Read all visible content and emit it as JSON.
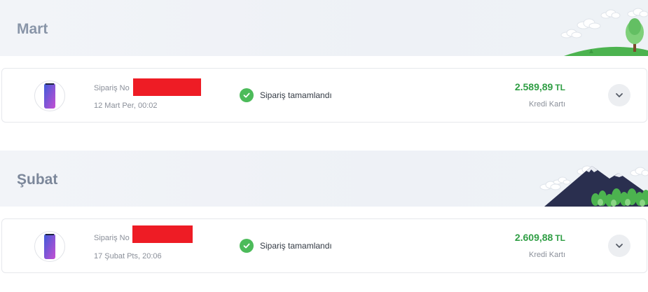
{
  "groups": [
    {
      "month": "Mart",
      "order": {
        "order_no_label": "Sipariş No",
        "date": "12 Mart Per, 00:02",
        "status": "Sipariş tamamlandı",
        "amount": "2.589,89",
        "currency": "TL",
        "payment": "Kredi Kartı"
      }
    },
    {
      "month": "Şubat",
      "order": {
        "order_no_label": "Sipariş No",
        "date": "17 Şubat Pts, 20:06",
        "status": "Sipariş tamamlandı",
        "amount": "2.609,88",
        "currency": "TL",
        "payment": "Kredi Kartı"
      }
    }
  ],
  "icons": {
    "status": "check-circle-icon",
    "expand": "chevron-down-icon",
    "product": "phone-thumbnail"
  },
  "colors": {
    "accent_green": "#2f9e44",
    "status_green": "#4cbb5a",
    "redaction": "#ee1c25"
  }
}
